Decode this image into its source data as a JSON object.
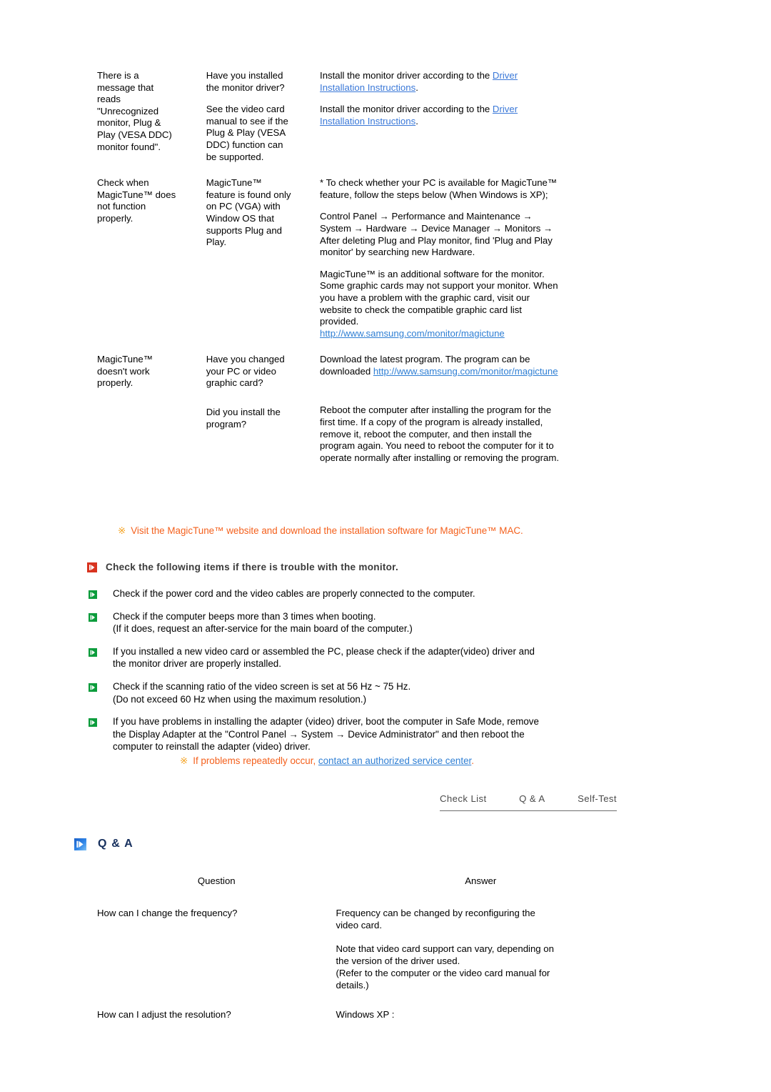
{
  "troubleshooting": {
    "rows": [
      {
        "symptom": [
          "There is a",
          "message that",
          "reads",
          "\"Unrecognized",
          "monitor, Plug &",
          "Play (VESA DDC)",
          "monitor found\"."
        ],
        "checks": [
          [
            "Have you installed",
            "the monitor driver?"
          ],
          [
            "See the video card",
            "manual to see if the",
            "Plug & Play (VESA",
            "DDC) function can",
            "be supported."
          ]
        ],
        "solutions": [
          {
            "lines": [
              "Install the monitor driver according to the ",
              "Driver",
              "Installation Instructions",
              "."
            ],
            "text_before": "Install the monitor driver according to the ",
            "link_1": "Driver",
            "link_2": "Installation Instructions",
            "text_after": "."
          },
          {
            "text_before": "Install the monitor driver according to the ",
            "link_1": "Driver",
            "link_2": "Installation Instructions",
            "text_after": "."
          }
        ]
      },
      {
        "symptom": [
          "Check when",
          "MagicTune™ does",
          "not function",
          "properly."
        ],
        "checks": [
          [
            "MagicTune™",
            "feature is found only",
            "on PC (VGA) with",
            "Window OS that",
            "supports Plug and",
            "Play."
          ]
        ],
        "solution_block_1": [
          "* To check whether your PC is available for MagicTune™",
          "feature, follow the steps below (When Windows is XP);"
        ],
        "solution_block_2": [
          "Control Panel → Performance and Maintenance →",
          "System → Hardware → Device Manager → Monitors →",
          "After deleting Plug and Play monitor, find 'Plug and Play",
          "monitor' by searching new Hardware."
        ],
        "solution_block_3": [
          "MagicTune™ is an additional software for the monitor.",
          "Some graphic cards may not support your monitor. When",
          "you have a problem with the graphic card, visit our",
          "website to check the compatible graphic card list",
          "provided."
        ],
        "solution_link": "http://www.samsung.com/monitor/magictune"
      },
      {
        "symptom": [
          "MagicTune™",
          "doesn't work",
          "properly."
        ],
        "checks": [
          [
            "Have you changed",
            "your PC or video",
            "graphic card?"
          ],
          [
            "Did you install the",
            "program?"
          ]
        ],
        "solution_a_line1": "Download the latest program. The program can be",
        "solution_a_line2_pre": "downloaded ",
        "solution_a_link": "http://www.samsung.com/monitor/magictune",
        "solution_b": [
          "Reboot the computer after installing the program for the",
          "first time. If a copy of the program is already installed,",
          "remove it, reboot the computer, and then install the",
          "program again. You need to reboot the computer for it to",
          "operate normally after installing or removing the program."
        ]
      }
    ]
  },
  "notice_magictune_mac": {
    "mark": "※",
    "text": "Visit the MagicTune™ website and download the installation software for MagicTune™ MAC."
  },
  "checklist": {
    "heading": "Check the following items if there is trouble with the monitor.",
    "heading_icon": "play-square-red-icon",
    "bullet_icon": "play-square-green-icon",
    "items": [
      [
        "Check if the power cord and the video cables are properly connected to the computer."
      ],
      [
        "Check if the computer beeps more than 3 times when booting.",
        "(If it does, request an after-service for the main board of the computer.)"
      ],
      [
        "If you installed a new video card or assembled the PC, please check if the adapter(video) driver and",
        "the monitor driver are properly installed."
      ],
      [
        "Check if the scanning ratio of the video screen is set at 56 Hz ~ 75 Hz.",
        "(Do not exceed 60 Hz when using the maximum resolution.)"
      ],
      [
        "If you have problems in installing the adapter (video) driver, boot the computer in Safe Mode, remove",
        "the Display Adapter at the \"Control Panel → System → Device Administrator\" and then reboot the",
        "computer to reinstall the adapter (video) driver."
      ]
    ]
  },
  "notice_service": {
    "mark": "※",
    "text": "If problems repeatedly occur, ",
    "link": "contact an authorized service center",
    "text_after": "."
  },
  "tabs": {
    "items": [
      {
        "label": "Check List"
      },
      {
        "label": "Q & A"
      },
      {
        "label": "Self-Test"
      }
    ]
  },
  "qa": {
    "heading": "Q & A",
    "heading_icon": "play-square-blue-icon",
    "columns": {
      "question": "Question",
      "answer": "Answer"
    },
    "rows": [
      {
        "question": "How can I change the frequency?",
        "answer_blocks": [
          [
            "Frequency can be changed by reconfiguring the",
            "video card."
          ],
          [
            "Note that video card support can vary, depending on",
            "the version of the driver used.",
            "(Refer to the computer or the video card manual for",
            "details.)"
          ]
        ]
      },
      {
        "question": "How can I adjust the resolution?",
        "answer_blocks": [
          [
            "Windows XP :"
          ]
        ]
      }
    ]
  },
  "colors": {
    "link_blue": "#3a78d8",
    "notice_orange": "#f4601c",
    "notice_mark": "#f4a01c",
    "heading_red": "#d8331f",
    "bullet_green": "#0c9c3c",
    "qa_blue": "#17305e"
  }
}
